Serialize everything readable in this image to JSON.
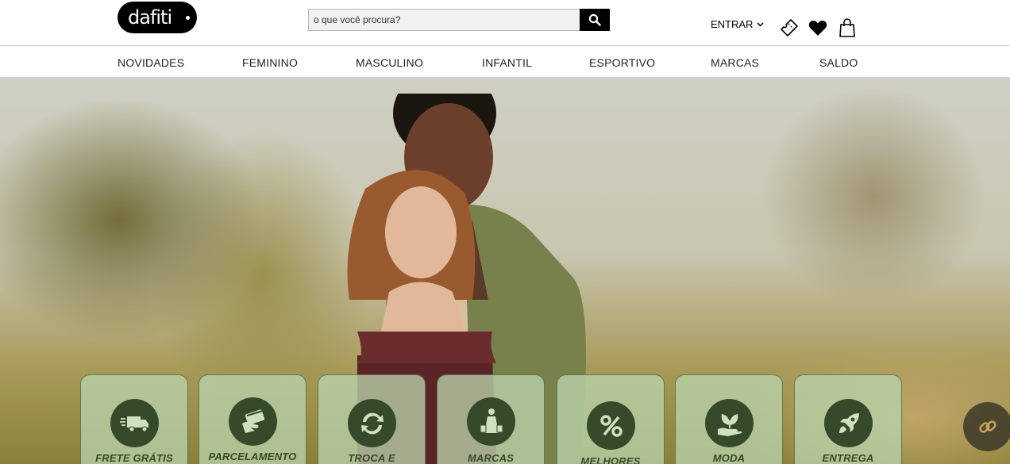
{
  "header": {
    "logo_text": "dafiti",
    "search_placeholder": "o que você procura?",
    "login_label": "ENTRAR",
    "icons": [
      "search-icon",
      "chevron-down-icon",
      "ticket-icon",
      "heart-icon",
      "shopping-bag-icon"
    ]
  },
  "nav": {
    "items": [
      "NOVIDADES",
      "FEMININO",
      "MASCULINO",
      "INFANTIL",
      "ESPORTIVO",
      "MARCAS",
      "SALDO"
    ]
  },
  "features": [
    {
      "label": "FRETE GRÁTIS",
      "icon": "truck-icon"
    },
    {
      "label": "PARCELAMENTO",
      "icon": "card-icon"
    },
    {
      "label": "TROCA E",
      "icon": "exchange-icon"
    },
    {
      "label": "MARCAS",
      "icon": "shopping-person-icon"
    },
    {
      "label": "MELHORES",
      "icon": "percent-icon"
    },
    {
      "label": "MODA",
      "icon": "plant-hand-icon"
    },
    {
      "label": "ENTREGA",
      "icon": "rocket-icon"
    }
  ],
  "colors": {
    "brand": "#000000",
    "feature_icon_bg": "#354a2b",
    "feature_card_bg": "#b9d2aa"
  }
}
